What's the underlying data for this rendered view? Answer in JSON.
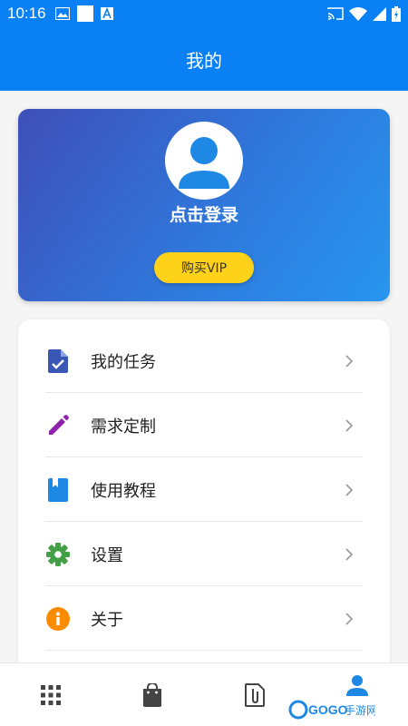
{
  "status_bar": {
    "time": "10:16",
    "left_icons": [
      "image-icon",
      "square-icon",
      "a-notification-icon"
    ],
    "right_icons": [
      "cast-icon",
      "wifi-icon",
      "signal-icon",
      "battery-icon"
    ]
  },
  "app_bar": {
    "title": "我的"
  },
  "profile": {
    "login_text": "点击登录",
    "vip_button": "购买VIP"
  },
  "menu": {
    "items": [
      {
        "label": "我的任务",
        "icon": "task-doc-icon",
        "color": "#3a57b5"
      },
      {
        "label": "需求定制",
        "icon": "pencil-icon",
        "color": "#8e24aa"
      },
      {
        "label": "使用教程",
        "icon": "book-icon",
        "color": "#1e88e5"
      },
      {
        "label": "设置",
        "icon": "gear-icon",
        "color": "#43a047"
      },
      {
        "label": "关于",
        "icon": "info-icon",
        "color": "#fb8c00"
      }
    ]
  },
  "bottom_nav": {
    "items": [
      {
        "icon": "apps-grid-icon",
        "active": false
      },
      {
        "icon": "shopping-bag-icon",
        "active": false
      },
      {
        "icon": "attachment-doc-icon",
        "active": false
      },
      {
        "icon": "person-icon",
        "active": true
      }
    ],
    "active_color": "#1e88e5",
    "inactive_color": "#444444"
  },
  "colors": {
    "primary": "#0a80f5",
    "vip": "#ffd21a"
  },
  "watermark": {
    "text": "GOGO手游网"
  }
}
